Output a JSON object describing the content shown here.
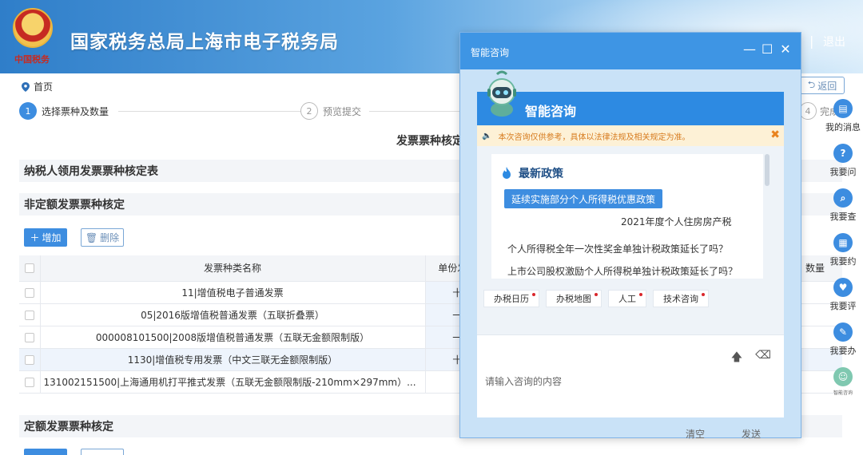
{
  "header": {
    "title": "国家税务总局上海市电子税务局",
    "emblem_text": "中国税务",
    "logout": "退出"
  },
  "breadcrumb": {
    "home": "首页"
  },
  "back_button": "返回",
  "steps": [
    {
      "num": "1",
      "label": "选择票种及数量"
    },
    {
      "num": "2",
      "label": "预览提交"
    },
    {
      "num": "4",
      "label": "完成"
    }
  ],
  "page_title": "发票票种核定",
  "sections": {
    "taxpayer": "纳税人领用发票票种核定表",
    "non_fixed": "非定额发票票种核定",
    "fixed": "定额发票票种核定"
  },
  "toolbar": {
    "add": "增加",
    "delete": "删除"
  },
  "table": {
    "headers": {
      "name": "发票种类名称",
      "unit": "单份发票",
      "count": "数量"
    },
    "rows": [
      {
        "name": "11|增值税电子普通发票",
        "unit": "十",
        "highlight": false
      },
      {
        "name": "05|2016版增值税普通发票（五联折叠票）",
        "unit": "一",
        "highlight": false
      },
      {
        "name": "000008101500|2008版增值税普通发票（五联无金额限制版）",
        "unit": "一",
        "highlight": false
      },
      {
        "name": "1130|增值税专用发票（中文三联无金额限制版）",
        "unit": "十",
        "highlight": true
      },
      {
        "name": "131002151500|上海通用机打平推式发票（五联无金额限制版-210mm×297mm）...",
        "unit": "",
        "highlight": false
      }
    ]
  },
  "right_sidebar": [
    {
      "icon": "message-icon",
      "label": "我的消息"
    },
    {
      "icon": "question-icon",
      "label": "我要问"
    },
    {
      "icon": "search-icon",
      "label": "我要查"
    },
    {
      "icon": "calendar-icon",
      "label": "我要约"
    },
    {
      "icon": "rate-icon",
      "label": "我要评"
    },
    {
      "icon": "edit-icon",
      "label": "我要办"
    },
    {
      "icon": "robot-icon",
      "label": "智能咨询"
    }
  ],
  "chat": {
    "window_title": "智能咨询",
    "header_title": "智能咨询",
    "notice": "本次咨询仅供参考，具体以法律法规及相关规定为准。",
    "policy_title": "最新政策",
    "policy_button": "延续实施部分个人所得税优惠政策",
    "policy_items": [
      "2021年度个人住房房产税",
      "个人所得税全年一次性奖金单独计税政策延长了吗？",
      "上市公司股权激励个人所得税单独计税政策延长了吗？"
    ],
    "quick_links": [
      "办税日历",
      "办税地图",
      "人工",
      "技术咨询"
    ],
    "input_placeholder": "请输入咨询的内容",
    "clear": "清空",
    "send": "发送"
  },
  "colors": {
    "primary": "#3d8de0",
    "chat_header": "#2d8ae2",
    "notice_text": "#d77b1e"
  }
}
